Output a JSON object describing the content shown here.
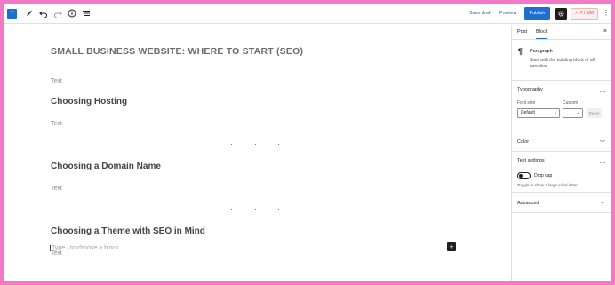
{
  "toolbar": {
    "save_draft": "Save draft",
    "preview": "Preview",
    "publish": "Publish",
    "seo_score": "7 / 100",
    "more": "⋮"
  },
  "editor": {
    "title": "SMALL BUSINESS WEBSITE: WHERE TO START (SEO)",
    "blocks": [
      {
        "type": "text",
        "content": "Text"
      },
      {
        "type": "heading",
        "content": "Choosing Hosting"
      },
      {
        "type": "text",
        "content": "Text"
      },
      {
        "type": "heading",
        "content": "Choosing a Domain Name"
      },
      {
        "type": "text",
        "content": "Text"
      },
      {
        "type": "heading",
        "content": "Choosing a Theme with SEO in Mind"
      },
      {
        "type": "text",
        "content": "Text"
      }
    ],
    "placeholder": "Type / to choose a block",
    "add_block": "+"
  },
  "sidebar": {
    "tabs": [
      "Post",
      "Block"
    ],
    "close": "×",
    "block_card": {
      "name": "Paragraph",
      "description": "Start with the building block of all narrative."
    },
    "typography": {
      "title": "Typography",
      "font_size_label": "Font size",
      "custom_label": "Custom",
      "font_size_value": "Default",
      "reset": "Reset"
    },
    "color": {
      "title": "Color"
    },
    "text_settings": {
      "title": "Text settings",
      "drop_cap": "Drop cap",
      "drop_cap_help": "Toggle to show a large initial letter."
    },
    "advanced": {
      "title": "Advanced"
    }
  },
  "colors": {
    "accent": "#1e6fd0",
    "border_frame": "#f378c7",
    "seo_red": "#d63638"
  }
}
